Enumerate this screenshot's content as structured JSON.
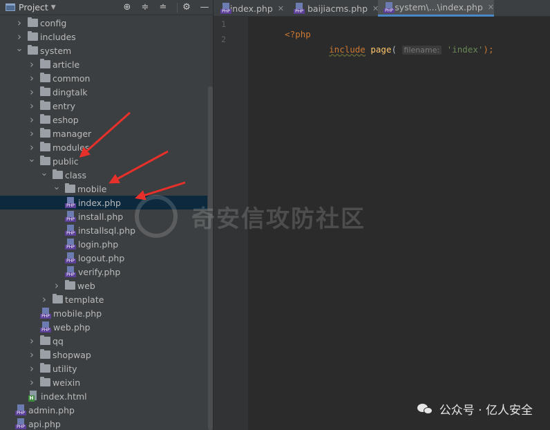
{
  "project_panel": {
    "title": "Project",
    "header_buttons": [
      "crosshair-icon",
      "expand-icon",
      "collapse-icon",
      "gear-icon",
      "minimize-icon"
    ]
  },
  "tree": [
    {
      "label": "config",
      "type": "folder",
      "depth": 1,
      "expanded": false
    },
    {
      "label": "includes",
      "type": "folder",
      "depth": 1,
      "expanded": false
    },
    {
      "label": "system",
      "type": "folder",
      "depth": 1,
      "expanded": true
    },
    {
      "label": "article",
      "type": "folder",
      "depth": 2,
      "expanded": false
    },
    {
      "label": "common",
      "type": "folder",
      "depth": 2,
      "expanded": false
    },
    {
      "label": "dingtalk",
      "type": "folder",
      "depth": 2,
      "expanded": false
    },
    {
      "label": "entry",
      "type": "folder",
      "depth": 2,
      "expanded": false
    },
    {
      "label": "eshop",
      "type": "folder",
      "depth": 2,
      "expanded": false
    },
    {
      "label": "manager",
      "type": "folder",
      "depth": 2,
      "expanded": false
    },
    {
      "label": "modules",
      "type": "folder",
      "depth": 2,
      "expanded": false
    },
    {
      "label": "public",
      "type": "folder",
      "depth": 2,
      "expanded": true
    },
    {
      "label": "class",
      "type": "folder",
      "depth": 3,
      "expanded": true
    },
    {
      "label": "mobile",
      "type": "folder",
      "depth": 4,
      "expanded": true
    },
    {
      "label": "index.php",
      "type": "php",
      "depth": 5,
      "selected": true
    },
    {
      "label": "install.php",
      "type": "php",
      "depth": 5
    },
    {
      "label": "installsql.php",
      "type": "php",
      "depth": 5
    },
    {
      "label": "login.php",
      "type": "php",
      "depth": 5
    },
    {
      "label": "logout.php",
      "type": "php",
      "depth": 5
    },
    {
      "label": "verify.php",
      "type": "php",
      "depth": 5
    },
    {
      "label": "web",
      "type": "folder",
      "depth": 4,
      "expanded": false
    },
    {
      "label": "template",
      "type": "folder",
      "depth": 3,
      "expanded": false
    },
    {
      "label": "mobile.php",
      "type": "php",
      "depth": 3
    },
    {
      "label": "web.php",
      "type": "php",
      "depth": 3
    },
    {
      "label": "qq",
      "type": "folder",
      "depth": 2,
      "expanded": false
    },
    {
      "label": "shopwap",
      "type": "folder",
      "depth": 2,
      "expanded": false
    },
    {
      "label": "utility",
      "type": "folder",
      "depth": 2,
      "expanded": false
    },
    {
      "label": "weixin",
      "type": "folder",
      "depth": 2,
      "expanded": false
    },
    {
      "label": "index.html",
      "type": "html",
      "depth": 2
    },
    {
      "label": "admin.php",
      "type": "php",
      "depth": 1
    },
    {
      "label": "api.php",
      "type": "php",
      "depth": 1
    }
  ],
  "tabs": [
    {
      "label": "index.php",
      "active": false
    },
    {
      "label": "baijiacms.php",
      "active": false
    },
    {
      "label": "system\\...\\index.php",
      "active": true
    }
  ],
  "editor": {
    "line_numbers": [
      "1",
      "2"
    ],
    "line1": "<?php",
    "line2_kw": "include",
    "line2_fn": "page",
    "line2_open": "(",
    "line2_hint": "filename:",
    "line2_str": "'index'",
    "line2_close": ");"
  },
  "watermark": "奇安信攻防社区",
  "caption": "公众号 · 亿人安全",
  "colors": {
    "panel_bg": "#3c3f41",
    "editor_bg": "#2b2b2b",
    "selection": "#0d293e",
    "arrow": "#e8302a",
    "tab_underline": "#4a88c7"
  }
}
